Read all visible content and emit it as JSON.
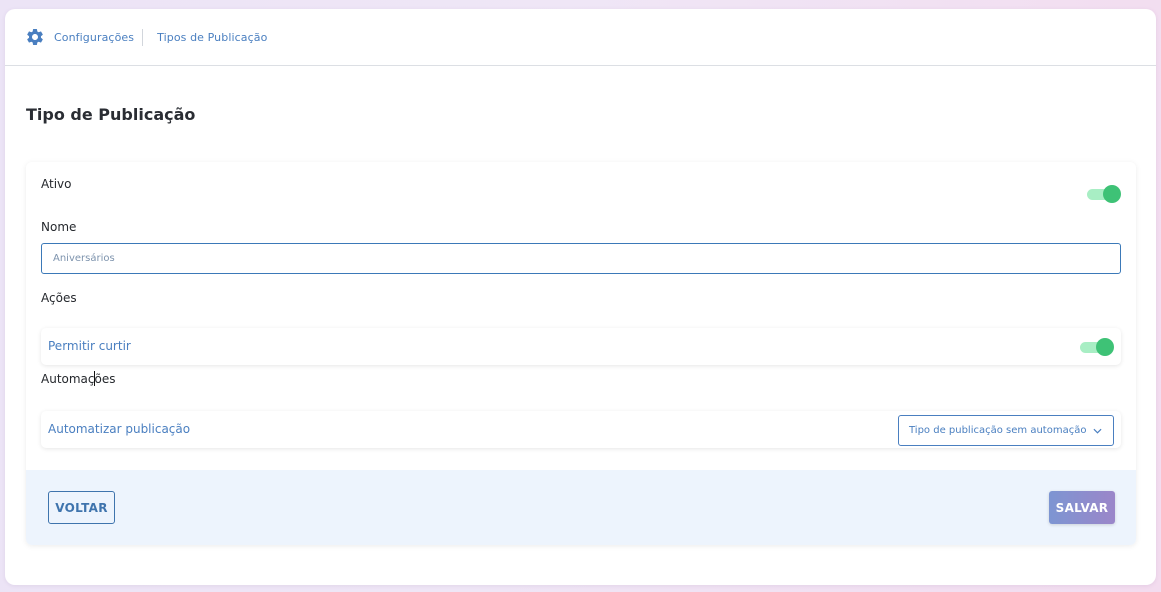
{
  "breadcrumb": {
    "icon": "gear-icon",
    "items": [
      {
        "label": "Configurações"
      },
      {
        "label": "Tipos de Publicação"
      }
    ]
  },
  "page": {
    "title": "Tipo de Publicação"
  },
  "form": {
    "active_label": "Ativo",
    "active_on": true,
    "name_label": "Nome",
    "name_value": "",
    "name_placeholder": "Aniversários",
    "actions_label": "Ações",
    "allow_like_label": "Permitir curtir",
    "allow_like_on": true,
    "automations_label": "Automações",
    "automate_label": "Automatizar publicação",
    "automation_select_value": "Tipo de publicação sem automação"
  },
  "footer": {
    "back_label": "VOLTAR",
    "save_label": "SALVAR"
  },
  "colors": {
    "accent": "#4a7fc0",
    "toggle_on": "#3ec276",
    "toggle_track": "#a8eec4",
    "footer_bg": "#edf4fd",
    "save_gradient_start": "#7d95d2",
    "save_gradient_end": "#9b86c9"
  }
}
